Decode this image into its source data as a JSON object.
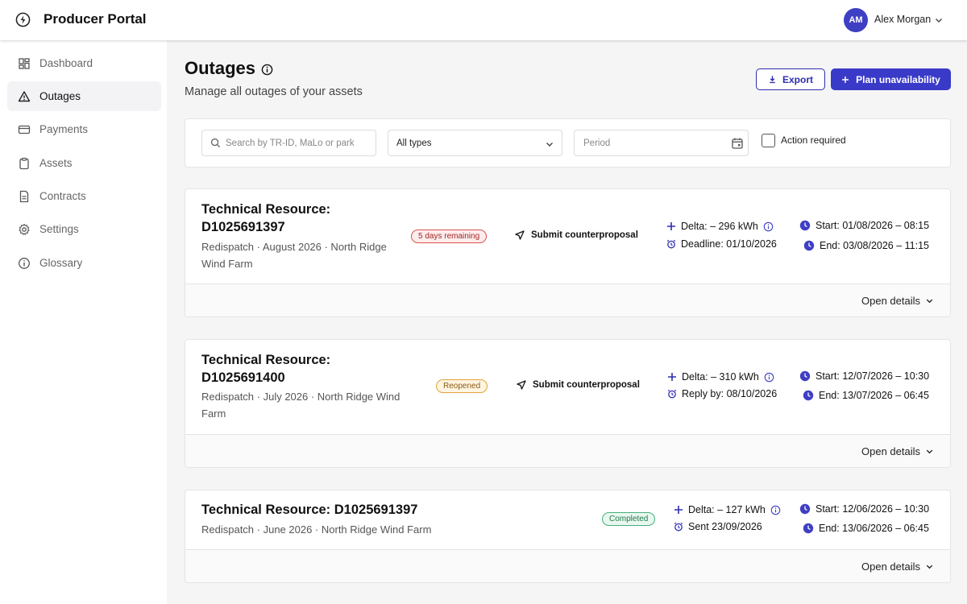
{
  "header": {
    "app_title": "Producer Portal",
    "user_initials": "AM",
    "user_name": "Alex Morgan"
  },
  "sidebar": {
    "items": [
      {
        "label": "Dashboard",
        "icon": "dashboard-icon"
      },
      {
        "label": "Outages",
        "icon": "warning-icon",
        "active": true
      },
      {
        "label": "Payments",
        "icon": "credit-card-icon"
      },
      {
        "label": "Assets",
        "icon": "clipboard-icon"
      },
      {
        "label": "Contracts",
        "icon": "document-icon"
      },
      {
        "label": "Settings",
        "icon": "gear-icon"
      },
      {
        "label": "Glossary",
        "icon": "info-icon"
      }
    ]
  },
  "page": {
    "title": "Outages",
    "subtitle": "Manage all outages of your assets",
    "export_label": "Export",
    "plan_label": "Plan unavailability"
  },
  "filters": {
    "search_placeholder": "Search by TR-ID, MaLo or park",
    "type_value": "All types",
    "period_placeholder": "Period",
    "action_required_label": "Action required",
    "action_required_checked": false
  },
  "outages": [
    {
      "title_line1": "Technical Resource:",
      "title_line2": "D1025691397",
      "meta_line1": "Redispatch · August 2026 · North Ridge",
      "meta_line2": "Wind Farm",
      "badge": "5 days remaining",
      "action": "Submit counterproposal",
      "delta": "Delta: – 296 kWh",
      "deadline": "Deadline: 01/10/2026",
      "start": "Start: 01/08/2026 – 08:15",
      "end": "End: 03/08/2026 – 11:15",
      "details_label": "Open details"
    },
    {
      "title_line1": "Technical Resource:",
      "title_line2": "D1025691400",
      "meta_line1": "Redispatch · July 2026 · North Ridge Wind",
      "meta_line2": "Farm",
      "badge": "Reopened",
      "action": "Submit counterproposal",
      "delta": "Delta: – 310 kWh",
      "deadline": "Reply by: 08/10/2026",
      "start": "Start: 12/07/2026 – 10:30",
      "end": "End: 13/07/2026 – 06:45",
      "details_label": "Open details"
    },
    {
      "title": "Technical Resource: D1025691397",
      "meta": "Redispatch · June 2026 · North Ridge Wind Farm",
      "badge": "Completed",
      "delta": "Delta: – 127 kWh",
      "deadline": "Sent 23/09/2026",
      "start": "Start: 12/06/2026 – 10:30",
      "end": "End: 13/06/2026 – 06:45",
      "details_label": "Open details"
    }
  ],
  "colors": {
    "accent": "#3a3ac8",
    "clock": "#3f3fc4",
    "badge_red": "#d9534f",
    "badge_amber": "#e0a43a",
    "badge_green": "#46b07a"
  }
}
